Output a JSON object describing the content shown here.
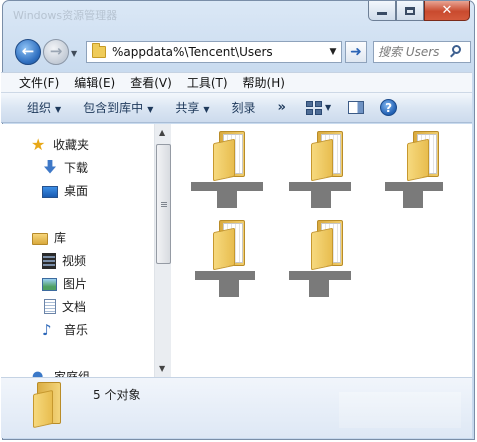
{
  "window": {
    "title": "Windows资源管理器"
  },
  "navigation": {
    "address_path": "%appdata%\\Tencent\\Users",
    "search_placeholder": "搜索 Users"
  },
  "menu": [
    {
      "label": "文件(F)"
    },
    {
      "label": "编辑(E)"
    },
    {
      "label": "查看(V)"
    },
    {
      "label": "工具(T)"
    },
    {
      "label": "帮助(H)"
    }
  ],
  "commands": {
    "organize": "组织",
    "include_in_library": "包含到库中",
    "share": "共享",
    "burn": "刻录",
    "more": "»"
  },
  "sidebar": {
    "favorites": {
      "label": "收藏夹",
      "items": [
        {
          "label": "下载",
          "icon": "download-icon"
        },
        {
          "label": "桌面",
          "icon": "desktop-icon"
        }
      ]
    },
    "libraries": {
      "label": "库",
      "items": [
        {
          "label": "视频",
          "icon": "video-icon"
        },
        {
          "label": "图片",
          "icon": "pictures-icon"
        },
        {
          "label": "文档",
          "icon": "documents-icon"
        },
        {
          "label": "音乐",
          "icon": "music-icon"
        }
      ]
    },
    "homegroup": {
      "label": "家庭组"
    }
  },
  "content": {
    "items": [
      {
        "name": ""
      },
      {
        "name": ""
      },
      {
        "name": ""
      },
      {
        "name": ""
      },
      {
        "name": ""
      }
    ]
  },
  "details": {
    "count_text": "5 个对象"
  },
  "colors": {
    "accent": "#2f6fc0",
    "folder": "#efcb58",
    "redaction": "#7a7a7a"
  }
}
